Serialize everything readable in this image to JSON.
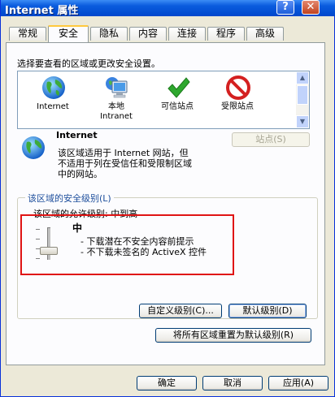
{
  "window": {
    "title": "Internet 属性",
    "help_glyph": "?",
    "close_glyph": "✕"
  },
  "tabs": [
    "常规",
    "安全",
    "隐私",
    "内容",
    "连接",
    "程序",
    "高级"
  ],
  "active_tab": "安全",
  "zones": {
    "prompt": "选择要查看的区域或更改安全设置。",
    "items": [
      {
        "label": "Internet",
        "icon": "globe-icon"
      },
      {
        "label": "本地\nIntranet",
        "icon": "computer-network-icon"
      },
      {
        "label": "可信站点",
        "icon": "checkmark-icon"
      },
      {
        "label": "受限站点",
        "icon": "no-entry-icon"
      }
    ]
  },
  "zone_info": {
    "title": "Internet",
    "description_line1": "该区域适用于 Internet 网站，但",
    "description_line2": "不适用于列在受信任和受限制区域",
    "description_line3": "中的网站。",
    "sites_button": "站点(S)"
  },
  "security_level": {
    "group_title": "该区域的安全级别(L)",
    "allowed_text": "该区域的允许级别: 中到高",
    "level_name": "中",
    "bullet1": "- 下载潜在不安全内容前提示",
    "bullet2": "- 不下载未签名的 ActiveX 控件",
    "slider_level": 0.5,
    "custom_button": "自定义级别(C)...",
    "default_button": "默认级别(D)"
  },
  "reset_button": "将所有区域重置为默认级别(R)",
  "footer": {
    "ok": "确定",
    "cancel": "取消",
    "apply": "应用(A)"
  },
  "colors": {
    "titlebar": "#0A5CDE",
    "highlight_box": "#E01414",
    "tab_accent": "#FFC83C"
  }
}
